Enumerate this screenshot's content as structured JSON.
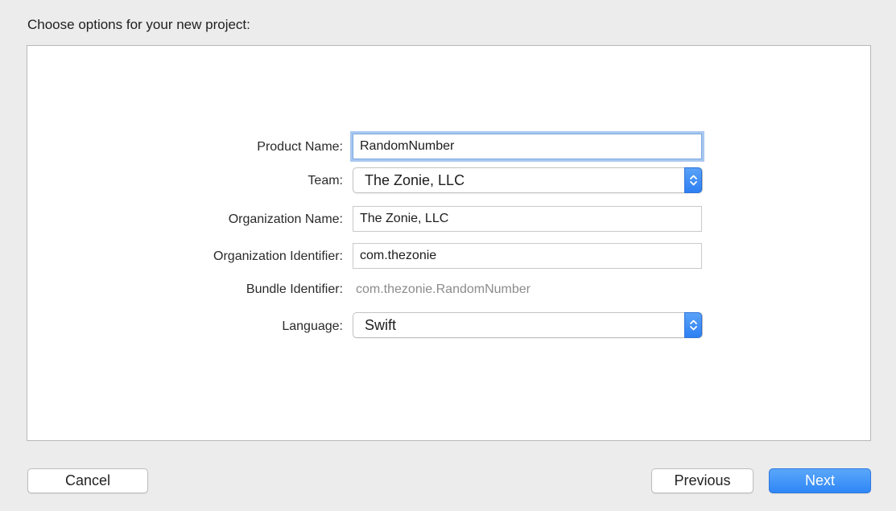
{
  "dialog": {
    "title": "Choose options for your new project:"
  },
  "form": {
    "product_name": {
      "label": "Product Name:",
      "value": "RandomNumber"
    },
    "team": {
      "label": "Team:",
      "value": "The Zonie, LLC"
    },
    "organization_name": {
      "label": "Organization Name:",
      "value": "The Zonie, LLC"
    },
    "organization_identifier": {
      "label": "Organization Identifier:",
      "value": "com.thezonie"
    },
    "bundle_identifier": {
      "label": "Bundle Identifier:",
      "value": "com.thezonie.RandomNumber"
    },
    "language": {
      "label": "Language:",
      "value": "Swift"
    }
  },
  "buttons": {
    "cancel": "Cancel",
    "previous": "Previous",
    "next": "Next"
  },
  "colors": {
    "accent": "#2f86f5",
    "focus_ring": "#a9c8f0",
    "panel_bg": "#ffffff",
    "window_bg": "#ececec"
  }
}
